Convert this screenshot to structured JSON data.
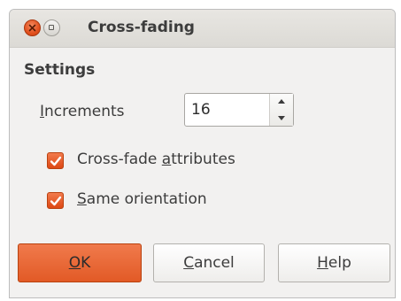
{
  "window": {
    "title": "Cross-fading",
    "controls": [
      "close-icon",
      "maximize-icon"
    ]
  },
  "settings": {
    "heading": "Settings",
    "increments": {
      "label_mnemonic": "I",
      "label_rest": "ncrements",
      "value": "16"
    },
    "cross_fade_attributes": {
      "label_before": "Cross-fade ",
      "label_mnemonic": "a",
      "label_after": "ttributes",
      "checked": true
    },
    "same_orientation": {
      "label_mnemonic": "S",
      "label_rest": "ame orientation",
      "checked": true
    }
  },
  "buttons": {
    "ok": {
      "mnemonic": "O",
      "rest": "K"
    },
    "cancel": {
      "mnemonic": "C",
      "rest": "ancel"
    },
    "help": {
      "mnemonic": "H",
      "rest": "elp"
    }
  },
  "colors": {
    "accent": "#dd4814",
    "dialog_bg": "#f2f1f0",
    "text": "#3c3c3c"
  }
}
